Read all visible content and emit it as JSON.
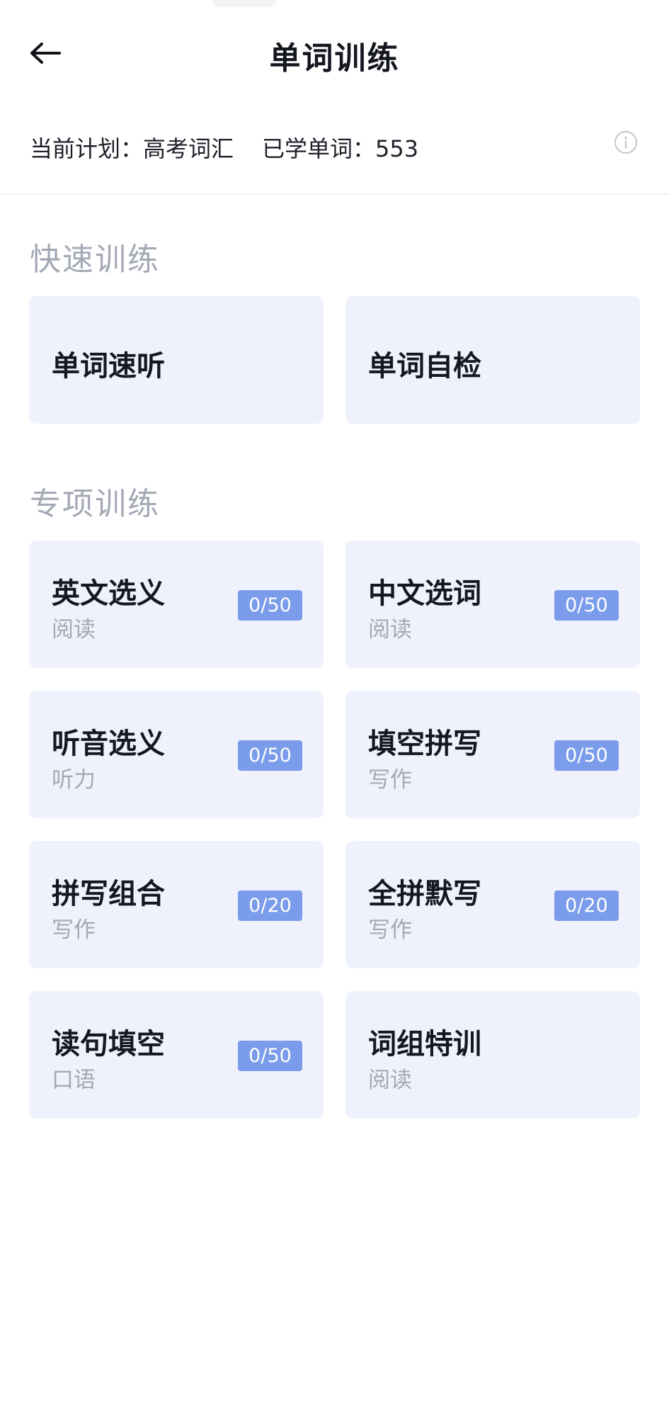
{
  "header": {
    "title": "单词训练",
    "back_icon": "arrow-left-icon"
  },
  "plan": {
    "plan_label": "当前计划：",
    "plan_value": "高考词汇",
    "learned_label": "已学单词：",
    "learned_value": "553",
    "info_icon": "info-circle-icon"
  },
  "quick_training": {
    "title": "快速训练",
    "items": [
      {
        "label": "单词速听"
      },
      {
        "label": "单词自检"
      }
    ]
  },
  "special_training": {
    "title": "专项训练",
    "items": [
      {
        "label": "英文选义",
        "skill": "阅读",
        "progress": "0/50"
      },
      {
        "label": "中文选词",
        "skill": "阅读",
        "progress": "0/50"
      },
      {
        "label": "听音选义",
        "skill": "听力",
        "progress": "0/50"
      },
      {
        "label": "填空拼写",
        "skill": "写作",
        "progress": "0/50"
      },
      {
        "label": "拼写组合",
        "skill": "写作",
        "progress": "0/20"
      },
      {
        "label": "全拼默写",
        "skill": "写作",
        "progress": "0/20"
      },
      {
        "label": "读句填空",
        "skill": "口语",
        "progress": "0/50"
      },
      {
        "label": "词组特训",
        "skill": "阅读"
      }
    ]
  },
  "colors": {
    "card_background": "#eff2fc",
    "badge": "#7b9cea",
    "section_title": "#a4a9b6",
    "skill_text": "#a5a9b4"
  }
}
